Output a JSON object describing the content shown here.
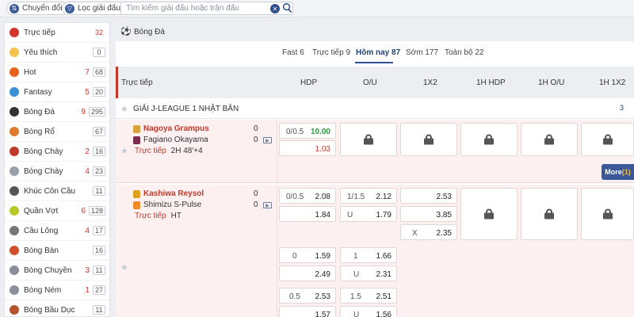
{
  "topbar": {
    "switch_label": "Chuyển đổi",
    "filter_label": "Lọc giải đấu",
    "search_placeholder": "Tìm kiếm giải đấu hoặc trận đấu"
  },
  "sidebar": {
    "items": [
      {
        "label": "Trực tiếp",
        "live": "",
        "count": "32",
        "count_color": "#d0342c",
        "icon": "live-icon",
        "icon_color": "#d0342c"
      },
      {
        "label": "Yêu thích",
        "live": "",
        "count": "0",
        "icon": "star-icon",
        "icon_color": "#f2c14e"
      },
      {
        "label": "Hot",
        "live": "7",
        "count": "68",
        "icon": "fire-icon",
        "icon_color": "#e8621f"
      },
      {
        "label": "Fantasy",
        "live": "5",
        "count": "20",
        "icon": "fantasy-icon",
        "icon_color": "#3b8fd6"
      },
      {
        "label": "Bóng Đá",
        "live": "9",
        "count": "295",
        "icon": "soccer-ball-icon",
        "icon_color": "#333333"
      },
      {
        "label": "Bóng Rổ",
        "live": "",
        "count": "67",
        "icon": "basketball-icon",
        "icon_color": "#e07a2c"
      },
      {
        "label": "Bóng Chày",
        "live": "2",
        "count": "16",
        "icon": "baseball-icon",
        "icon_color": "#c0392b"
      },
      {
        "label": "Bóng Chày",
        "live": "4",
        "count": "23",
        "icon": "baseball-icon",
        "icon_color": "#9aa0a8"
      },
      {
        "label": "Khúc Côn Cầu",
        "live": "",
        "count": "11",
        "icon": "hockey-stick-icon",
        "icon_color": "#555555"
      },
      {
        "label": "Quần Vợt",
        "live": "6",
        "count": "128",
        "icon": "tennis-ball-icon",
        "icon_color": "#b5c825"
      },
      {
        "label": "Cầu Lông",
        "live": "4",
        "count": "17",
        "icon": "shuttlecock-icon",
        "icon_color": "#777777"
      },
      {
        "label": "Bóng Bàn",
        "live": "",
        "count": "16",
        "icon": "table-tennis-icon",
        "icon_color": "#d0502c"
      },
      {
        "label": "Bóng Chuyền",
        "live": "3",
        "count": "11",
        "icon": "volleyball-icon",
        "icon_color": "#8a8f99"
      },
      {
        "label": "Bóng Ném",
        "live": "1",
        "count": "27",
        "icon": "handball-icon",
        "icon_color": "#8a8f99"
      },
      {
        "label": "Bóng Bầu Dục",
        "live": "",
        "count": "11",
        "icon": "rugby-ball-icon",
        "icon_color": "#b5542c"
      }
    ]
  },
  "main": {
    "title": "Bóng Đá",
    "tabs": [
      {
        "label": "Fast 6"
      },
      {
        "label": "Trực tiếp 9"
      },
      {
        "label": "Hôm nay 87"
      },
      {
        "label": "Sớm 177"
      },
      {
        "label": "Toàn bộ 22"
      }
    ],
    "active_tab": "Hôm nay 87",
    "columns": [
      "Trực tiếp",
      "HDP",
      "O/U",
      "1X2",
      "1H HDP",
      "1H O/U",
      "1H 1X2"
    ],
    "league": {
      "name": "GIẢI J-LEAGUE 1 NHẬT BẢN",
      "count": "3"
    },
    "matches": [
      {
        "home": "Nagoya Grampus",
        "away": "Fagiano Okayama",
        "home_score": "0",
        "away_score": "0",
        "status": "Trực tiếp",
        "time": "2H 48'+4",
        "hdp_line": "0/0.5",
        "hdp_home": "10.00",
        "hdp_away": "1.03",
        "more_label": "More",
        "more_count": "(1)"
      },
      {
        "home": "Kashiwa Reysol",
        "away": "Shimizu S-Pulse",
        "home_score": "0",
        "away_score": "0",
        "status": "Trực tiếp",
        "time": "HT",
        "rows": [
          {
            "hdp_line": "0/0.5",
            "hdp_home": "2.08",
            "hdp_away": "1.84",
            "ou_line": "1/1.5",
            "ou_over": "2.12",
            "ou_under_label": "U",
            "ou_under": "1.79"
          },
          {
            "hdp_line": "0",
            "hdp_home": "1.59",
            "hdp_away": "2.49",
            "ou_line": "1",
            "ou_over": "1.66",
            "ou_under_label": "U",
            "ou_under": "2.31"
          },
          {
            "hdp_line": "0.5",
            "hdp_home": "2.53",
            "hdp_away": "1.57",
            "ou_line": "1.5",
            "ou_over": "2.51",
            "ou_under_label": "U",
            "ou_under": "1.56"
          }
        ],
        "x12_home": "2.53",
        "x12_away": "3.85",
        "x12_draw_label": "X",
        "x12_draw": "2.35"
      }
    ]
  }
}
